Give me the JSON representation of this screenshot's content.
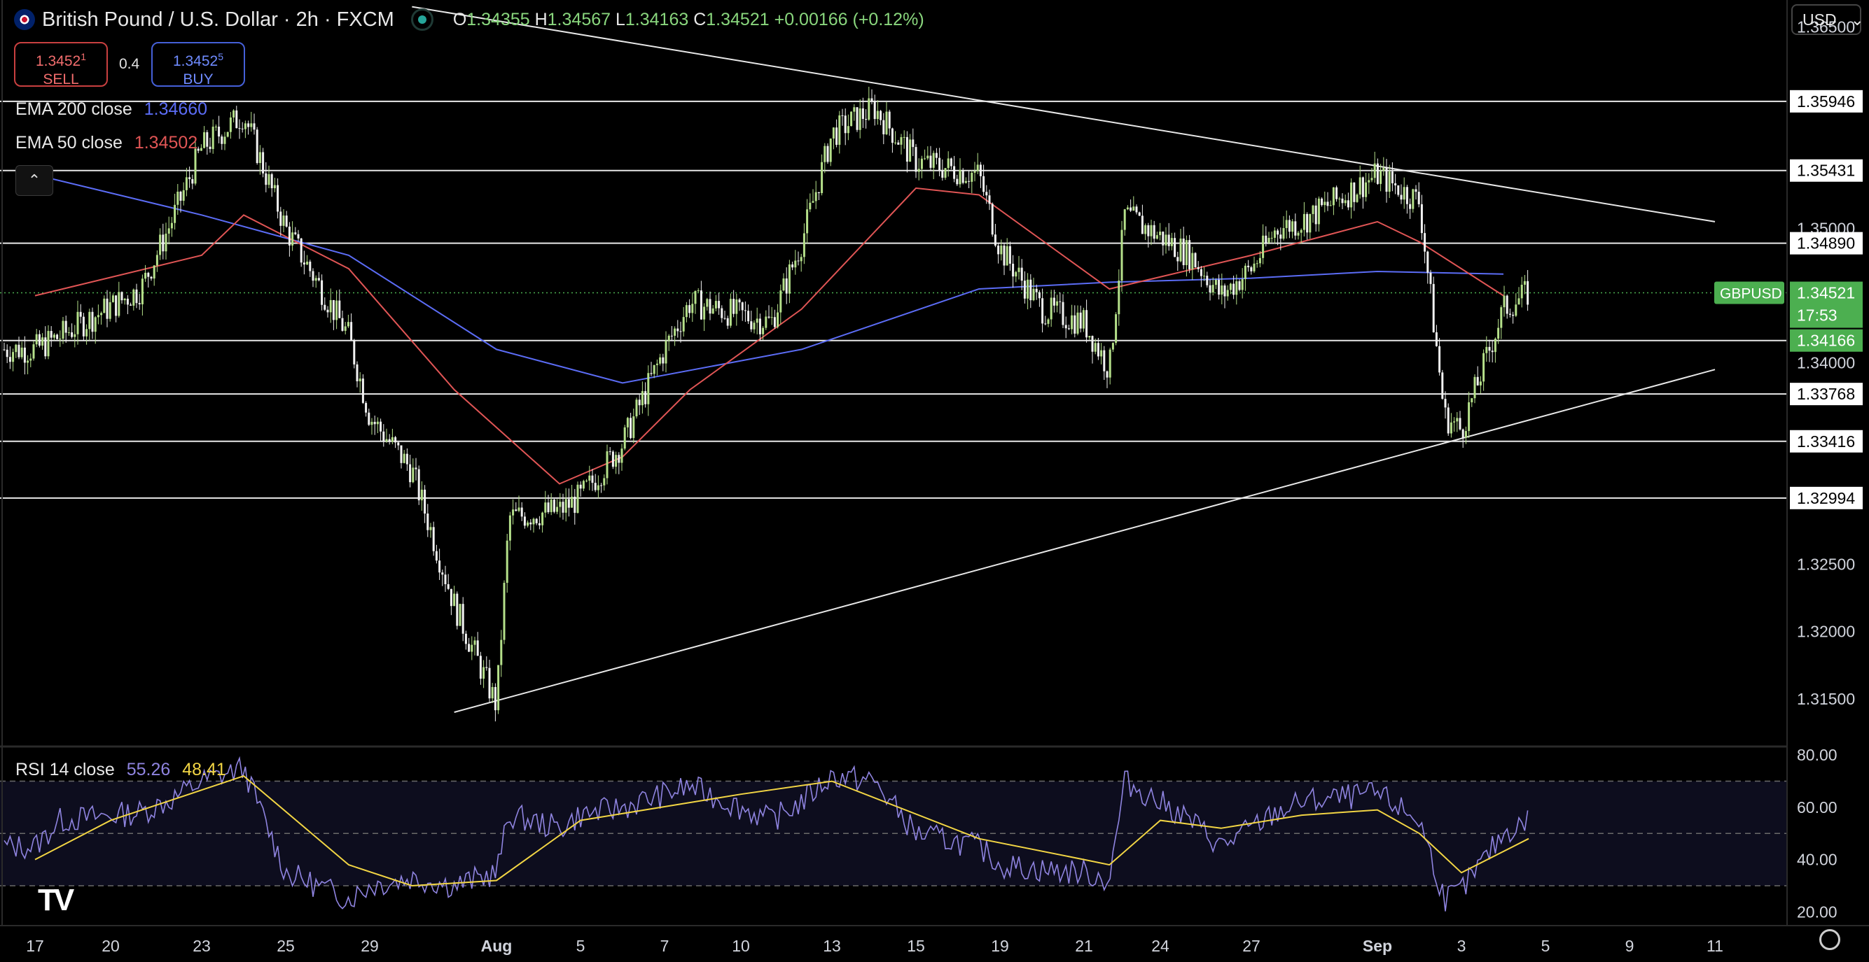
{
  "header": {
    "symbol_title": "British Pound / U.S. Dollar · 2h · FXCM",
    "ohlc": {
      "o": "1.34355",
      "h": "1.34567",
      "l": "1.34163",
      "c": "1.34521",
      "change": "+0.00166 (+0.12%)"
    }
  },
  "trade": {
    "sell_price_main": "1.3452",
    "sell_price_sup": "1",
    "sell_label": "SELL",
    "spread": "0.4",
    "buy_price_main": "1.3452",
    "buy_price_sup": "5",
    "buy_label": "BUY"
  },
  "indicators": {
    "ema200": {
      "label": "EMA 200 close",
      "value": "1.34660",
      "color": "#5b6cf5"
    },
    "ema50": {
      "label": "EMA 50 close",
      "value": "1.34502",
      "color": "#e05555"
    },
    "rsi": {
      "label": "RSI 14 close",
      "value": "55.26",
      "ma_value": "48.41",
      "value_color": "#8f84e0",
      "ma_color": "#f2d544"
    }
  },
  "currency_selector": "USD",
  "collapse_icon": "chevron-up-icon",
  "settings_icon": "gear-icon",
  "logo_text": "TV",
  "price_axis": [
    "1.36500",
    "1.35000",
    "1.34000",
    "1.32500",
    "1.32000",
    "1.31500"
  ],
  "level_labels": [
    "1.35946",
    "1.35431",
    "1.34890",
    "1.34166",
    "1.33768",
    "1.33416",
    "1.32994"
  ],
  "current_price": {
    "symbol": "GBPUSD",
    "price": "1.34521",
    "countdown": "17:53",
    "color": "#4caf50"
  },
  "rsi_axis": [
    "80.00",
    "60.00",
    "40.00",
    "20.00"
  ],
  "time_axis": [
    "17",
    "20",
    "23",
    "25",
    "29",
    "Aug",
    "5",
    "7",
    "10",
    "13",
    "15",
    "19",
    "21",
    "24",
    "27",
    "Sep",
    "3",
    "5",
    "9",
    "11"
  ],
  "chart_data": {
    "type": "candlestick",
    "symbol": "GBPUSD",
    "timeframe": "2h",
    "y_range": [
      1.3115,
      1.367
    ],
    "horizontal_levels": [
      1.35946,
      1.35431,
      1.3489,
      1.34166,
      1.33768,
      1.33416,
      1.32994
    ],
    "price_path": [
      [
        "Jul 17",
        1.341
      ],
      [
        "Jul 18",
        1.342
      ],
      [
        "Jul 21",
        1.3455
      ],
      [
        "Jul 22",
        1.3505
      ],
      [
        "Jul 23",
        1.356
      ],
      [
        "Jul 24",
        1.3585
      ],
      [
        "Jul 25",
        1.35
      ],
      [
        "Jul 28",
        1.342
      ],
      [
        "Jul 29",
        1.336
      ],
      [
        "Jul 30",
        1.332
      ],
      [
        "Jul 31",
        1.322
      ],
      [
        "Aug 1",
        1.3145
      ],
      [
        "Aug 1b",
        1.3285
      ],
      [
        "Aug 4",
        1.329
      ],
      [
        "Aug 5",
        1.33
      ],
      [
        "Aug 6",
        1.334
      ],
      [
        "Aug 7",
        1.341
      ],
      [
        "Aug 8",
        1.3445
      ],
      [
        "Aug 11",
        1.343
      ],
      [
        "Aug 12",
        1.349
      ],
      [
        "Aug 13",
        1.357
      ],
      [
        "Aug 14",
        1.359
      ],
      [
        "Aug 15",
        1.355
      ],
      [
        "Aug 18",
        1.354
      ],
      [
        "Aug 19",
        1.3485
      ],
      [
        "Aug 20",
        1.344
      ],
      [
        "Aug 21",
        1.343
      ],
      [
        "Aug 22",
        1.3395
      ],
      [
        "Aug 22b",
        1.351
      ],
      [
        "Aug 25",
        1.348
      ],
      [
        "Aug 26",
        1.345
      ],
      [
        "Aug 27",
        1.347
      ],
      [
        "Aug 28",
        1.35
      ],
      [
        "Aug 29",
        1.3505
      ],
      [
        "Sep 1",
        1.354
      ],
      [
        "Sep 2",
        1.352
      ],
      [
        "Sep 2b",
        1.336
      ],
      [
        "Sep 3",
        1.335
      ],
      [
        "Sep 4",
        1.344
      ],
      [
        "Sep 4b",
        1.3452
      ]
    ],
    "ema50": [
      [
        "Jul 17",
        1.345
      ],
      [
        "Jul 23",
        1.348
      ],
      [
        "Jul 24",
        1.351
      ],
      [
        "Jul 28",
        1.347
      ],
      [
        "Jul 31",
        1.338
      ],
      [
        "Aug 4",
        1.331
      ],
      [
        "Aug 6",
        1.333
      ],
      [
        "Aug 8",
        1.338
      ],
      [
        "Aug 12",
        1.344
      ],
      [
        "Aug 15",
        1.353
      ],
      [
        "Aug 18",
        1.3525
      ],
      [
        "Aug 22",
        1.3455
      ],
      [
        "Aug 27",
        1.348
      ],
      [
        "Sep 1",
        1.3505
      ],
      [
        "Sep 2",
        1.349
      ],
      [
        "Sep 4",
        1.345
      ]
    ],
    "ema200": [
      [
        "Jul 17",
        1.354
      ],
      [
        "Jul 23",
        1.351
      ],
      [
        "Jul 28",
        1.348
      ],
      [
        "Aug 1",
        1.341
      ],
      [
        "Aug 6",
        1.3385
      ],
      [
        "Aug 12",
        1.341
      ],
      [
        "Aug 18",
        1.3455
      ],
      [
        "Aug 22",
        1.346
      ],
      [
        "Aug 27",
        1.3463
      ],
      [
        "Sep 1",
        1.3468
      ],
      [
        "Sep 4",
        1.3466
      ]
    ],
    "trendlines": [
      {
        "from": [
          "Jul 30",
          1.3665
        ],
        "to": [
          "Sep 11",
          1.3505
        ]
      },
      {
        "from": [
          "Jul 31",
          1.314
        ],
        "to": [
          "Sep 11",
          1.3395
        ]
      }
    ],
    "rsi": {
      "y_range": [
        20,
        80
      ],
      "bands": [
        30,
        50,
        70
      ],
      "series": [
        [
          "Jul 17",
          45
        ],
        [
          "Jul 18",
          55
        ],
        [
          "Jul 21",
          58
        ],
        [
          "Jul 22",
          63
        ],
        [
          "Jul 23",
          70
        ],
        [
          "Jul 24",
          75
        ],
        [
          "Jul 25",
          35
        ],
        [
          "Jul 28",
          25
        ],
        [
          "Jul 29",
          30
        ],
        [
          "Jul 30",
          33
        ],
        [
          "Jul 31",
          30
        ],
        [
          "Aug 1",
          35
        ],
        [
          "Aug 1b",
          57
        ],
        [
          "Aug 4",
          52
        ],
        [
          "Aug 5",
          57
        ],
        [
          "Aug 6",
          60
        ],
        [
          "Aug 7",
          65
        ],
        [
          "Aug 8",
          68
        ],
        [
          "Aug 11",
          55
        ],
        [
          "Aug 12",
          62
        ],
        [
          "Aug 13",
          72
        ],
        [
          "Aug 14",
          70
        ],
        [
          "Aug 15",
          50
        ],
        [
          "Aug 18",
          45
        ],
        [
          "Aug 19",
          38
        ],
        [
          "Aug 20",
          36
        ],
        [
          "Aug 21",
          35
        ],
        [
          "Aug 22",
          32
        ],
        [
          "Aug 22b",
          70
        ],
        [
          "Aug 25",
          55
        ],
        [
          "Aug 26",
          45
        ],
        [
          "Aug 27",
          52
        ],
        [
          "Aug 28",
          58
        ],
        [
          "Aug 29",
          62
        ],
        [
          "Sep 1",
          65
        ],
        [
          "Sep 2",
          55
        ],
        [
          "Sep 2b",
          25
        ],
        [
          "Sep 3",
          28
        ],
        [
          "Sep 4",
          50
        ],
        [
          "Sep 4b",
          55
        ]
      ],
      "ma": [
        [
          "Jul 17",
          40
        ],
        [
          "Jul 20",
          55
        ],
        [
          "Jul 24",
          72
        ],
        [
          "Jul 28",
          38
        ],
        [
          "Jul 30",
          30
        ],
        [
          "Aug 1",
          32
        ],
        [
          "Aug 5",
          55
        ],
        [
          "Aug 10",
          65
        ],
        [
          "Aug 13",
          70
        ],
        [
          "Aug 18",
          48
        ],
        [
          "Aug 21",
          40
        ],
        [
          "Aug 22",
          38
        ],
        [
          "Aug 24",
          55
        ],
        [
          "Aug 26",
          52
        ],
        [
          "Aug 29",
          57
        ],
        [
          "Sep 1",
          59
        ],
        [
          "Sep 2",
          50
        ],
        [
          "Sep 3",
          35
        ],
        [
          "Sep 4b",
          48
        ]
      ]
    }
  }
}
